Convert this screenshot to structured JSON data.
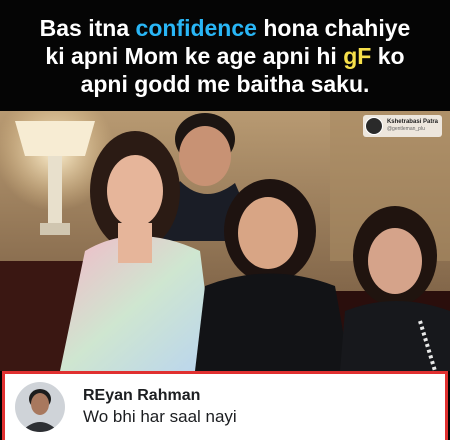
{
  "caption": {
    "line1": {
      "before": "Bas itna ",
      "highlight": "confidence",
      "after": " hona chahiye"
    },
    "line2": {
      "before": "ki apni Mom ke age apni hi ",
      "highlight": "gF",
      "after": " ko"
    },
    "line3": "apni godd me baitha saku.",
    "highlight_colors": {
      "blue": "#29b6f6",
      "yellow": "#f6e04b"
    }
  },
  "watermark": {
    "name": "Kshetrabasi Patra",
    "handle": "@gentleman_plu"
  },
  "comment": {
    "author": "REyan Rahman",
    "text": "Wo bhi har saal nayi",
    "border_color": "#e03030"
  }
}
